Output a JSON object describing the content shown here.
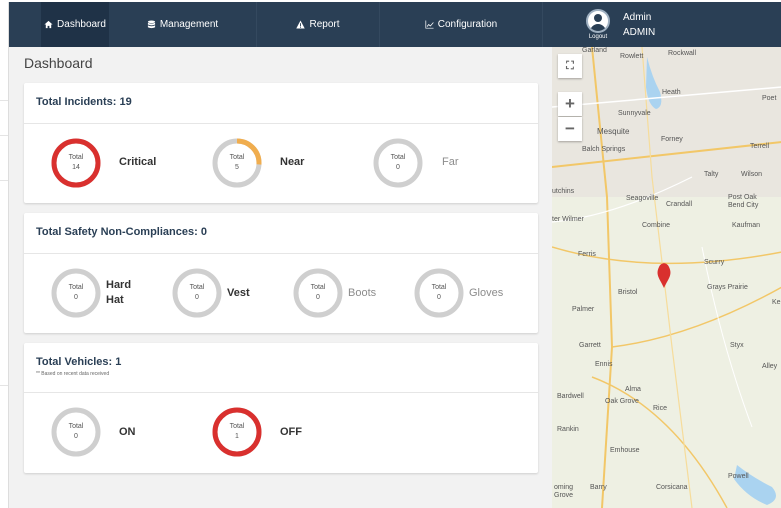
{
  "nav": {
    "items": [
      {
        "label": "Dashboard",
        "icon": "home-icon"
      },
      {
        "label": "Management",
        "icon": "database-icon"
      },
      {
        "label": "Report",
        "icon": "warning-icon"
      },
      {
        "label": "Configuration",
        "icon": "line-chart-icon"
      }
    ],
    "user": {
      "name": "Admin",
      "role": "ADMIN",
      "logout": "Logout"
    }
  },
  "page": {
    "title": "Dashboard"
  },
  "cards": {
    "incidents": {
      "title": "Total Incidents: 19",
      "gauges": [
        {
          "caption": "Total",
          "value": "14",
          "label": "Critical",
          "fraction": 1.0,
          "color": "#d9302e"
        },
        {
          "caption": "Total",
          "value": "5",
          "label": "Near",
          "fraction": 0.26,
          "color": "#f0ad4e"
        },
        {
          "caption": "Total",
          "value": "0",
          "label": "Far",
          "fraction": 0,
          "color": "#cccccc"
        }
      ]
    },
    "safety": {
      "title": "Total Safety Non-Compliances: 0",
      "gauges": [
        {
          "caption": "Total",
          "value": "0",
          "label_line1": "Hard",
          "label_line2": "Hat"
        },
        {
          "caption": "Total",
          "value": "0",
          "label": "Vest"
        },
        {
          "caption": "Total",
          "value": "0",
          "label": "Boots"
        },
        {
          "caption": "Total",
          "value": "0",
          "label": "Gloves"
        }
      ]
    },
    "vehicles": {
      "title": "Total Vehicles: 1",
      "note": "** Based on recent data received",
      "gauges": [
        {
          "caption": "Total",
          "value": "0",
          "label": "ON",
          "fraction": 0
        },
        {
          "caption": "Total",
          "value": "1",
          "label": "OFF",
          "fraction": 1.0,
          "color": "#d9302e"
        }
      ]
    }
  },
  "map": {
    "places": [
      "Garland",
      "Rowlett",
      "Rockwall",
      "Heath",
      "Poet",
      "Sunnyvale",
      "Mesquite",
      "Forney",
      "Terrell",
      "Balch Springs",
      "Talty",
      "Wilson",
      "Seagoville",
      "Crandall",
      "Post Oak Bend City",
      "Combine",
      "Kaufman",
      "Ferris",
      "Scurry",
      "Bristol",
      "Grays Prairie",
      "Palmer",
      "Garrett",
      "Styx",
      "Ennis",
      "Alma",
      "Bardwell",
      "Oak Grove",
      "Rice",
      "Rankin",
      "Emhouse",
      "Powell",
      "Barry",
      "Corsicana",
      "Grove",
      "Alley",
      "Hutchins",
      "Wilmer"
    ],
    "place_partials": [
      "utchins",
      "ter Wilmer",
      "Ke",
      "oming",
      "Alley",
      "Poet"
    ],
    "route_shields": [
      "276",
      "66",
      "205",
      "635",
      "175",
      "557",
      "20",
      "80",
      "34",
      "175",
      "45",
      "287",
      "34",
      "45",
      "31",
      "22"
    ],
    "controls": {
      "fullscreen": "fullscreen-icon",
      "zoom_in": "+",
      "zoom_out": "−"
    }
  }
}
